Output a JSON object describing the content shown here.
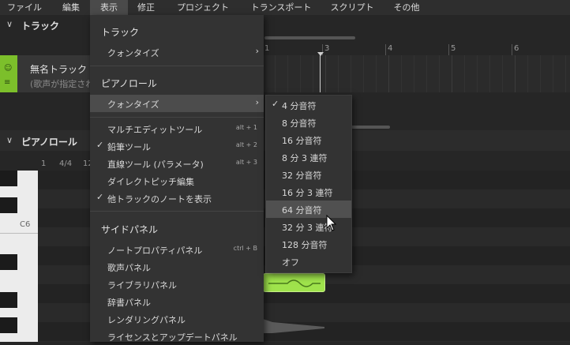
{
  "menubar": {
    "items": [
      "ファイル",
      "編集",
      "表示",
      "修正",
      "プロジェクト",
      "トランスポート",
      "スクリプト",
      "その他"
    ],
    "active_index": 2
  },
  "track_panel": {
    "title": "トラック",
    "track_name": "無名トラック",
    "track_sub": "(歌声が指定され",
    "ruler": [
      "3",
      "4",
      "5",
      "6"
    ],
    "ruler_first": "1"
  },
  "piano_roll": {
    "title": "ピアノロール",
    "ruler_bar": "1",
    "ruler_sig": "4/4",
    "ruler_tempo": "12",
    "c6_label": "C6"
  },
  "view_menu": {
    "track_section": "トラック",
    "track_quantize": "クォンタイズ",
    "piano_section": "ピアノロール",
    "piano_quantize": "クォンタイズ",
    "tools": [
      {
        "label": "マルチエディットツール",
        "shortcut": "alt + 1",
        "checked": false
      },
      {
        "label": "鉛筆ツール",
        "shortcut": "alt + 2",
        "checked": true
      },
      {
        "label": "直線ツール (パラメータ)",
        "shortcut": "alt + 3",
        "checked": false
      },
      {
        "label": "ダイレクトピッチ編集",
        "shortcut": "",
        "checked": false
      },
      {
        "label": "他トラックのノートを表示",
        "shortcut": "",
        "checked": true
      }
    ],
    "side_section": "サイドパネル",
    "panels": [
      {
        "label": "ノートプロパティパネル",
        "shortcut": "ctrl + B"
      },
      {
        "label": "歌声パネル",
        "shortcut": ""
      },
      {
        "label": "ライブラリパネル",
        "shortcut": ""
      },
      {
        "label": "辞書パネル",
        "shortcut": ""
      },
      {
        "label": "レンダリングパネル",
        "shortcut": ""
      },
      {
        "label": "ライセンスとアップデートパネル",
        "shortcut": ""
      }
    ]
  },
  "quantize_submenu": {
    "items": [
      "4 分音符",
      "8 分音符",
      "16 分音符",
      "8 分 3 連符",
      "32 分音符",
      "16 分 3 連符",
      "64 分音符",
      "32 分 3 連符",
      "128 分音符",
      "オフ"
    ],
    "checked_index": 0,
    "highlighted_index": 6
  },
  "colors": {
    "accent_green": "#7cbf2b",
    "note_green": "#9fe34c",
    "menu_bg": "#333333"
  }
}
